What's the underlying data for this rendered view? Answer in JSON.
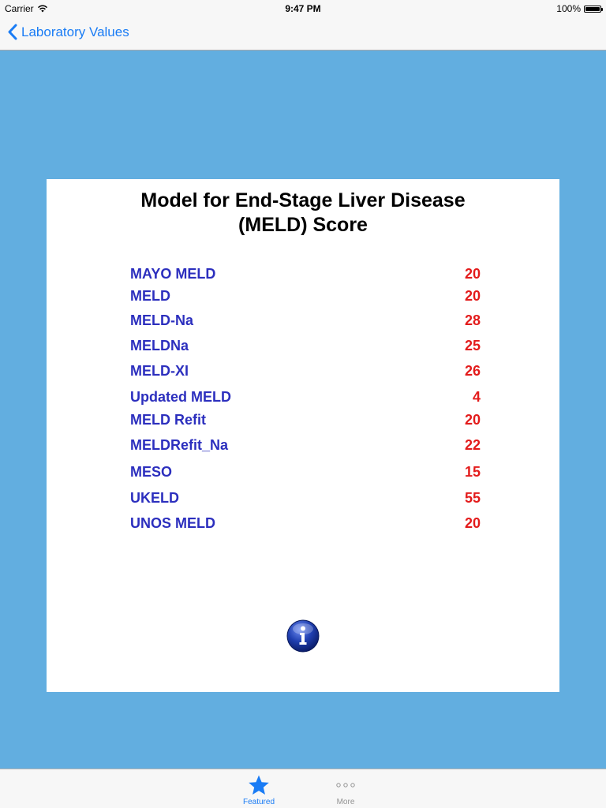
{
  "status_bar": {
    "carrier": "Carrier",
    "time": "9:47 PM",
    "battery": "100%",
    "battery_level": 1.0
  },
  "nav": {
    "back_label": "Laboratory Values",
    "back_icon": "chevron-left-icon"
  },
  "card": {
    "title_line1": "Model for End-Stage Liver Disease",
    "title_line2": "(MELD) Score",
    "scores": [
      {
        "name": "MAYO MELD",
        "value": "20"
      },
      {
        "name": "MELD",
        "value": "20"
      },
      {
        "name": "MELD-Na",
        "value": "28"
      },
      {
        "name": "MELDNa",
        "value": "25"
      },
      {
        "name": "MELD-XI",
        "value": "26"
      },
      {
        "name": "Updated MELD",
        "value": "4"
      },
      {
        "name": "MELD Refit",
        "value": "20"
      },
      {
        "name": "MELDRefit_Na",
        "value": "22"
      },
      {
        "name": "MESO",
        "value": "15"
      },
      {
        "name": "UKELD",
        "value": "55"
      },
      {
        "name": "UNOS MELD",
        "value": "20"
      }
    ],
    "info_icon": "info-icon"
  },
  "tab_bar": {
    "tabs": [
      {
        "label": "Featured",
        "icon": "star-icon",
        "selected": true
      },
      {
        "label": "More",
        "icon": "more-icon",
        "selected": false
      }
    ]
  },
  "colors": {
    "background": "#62aee0",
    "accent": "#1a7cf5",
    "score_name": "#2c2fbe",
    "score_value": "#e31b1b"
  }
}
